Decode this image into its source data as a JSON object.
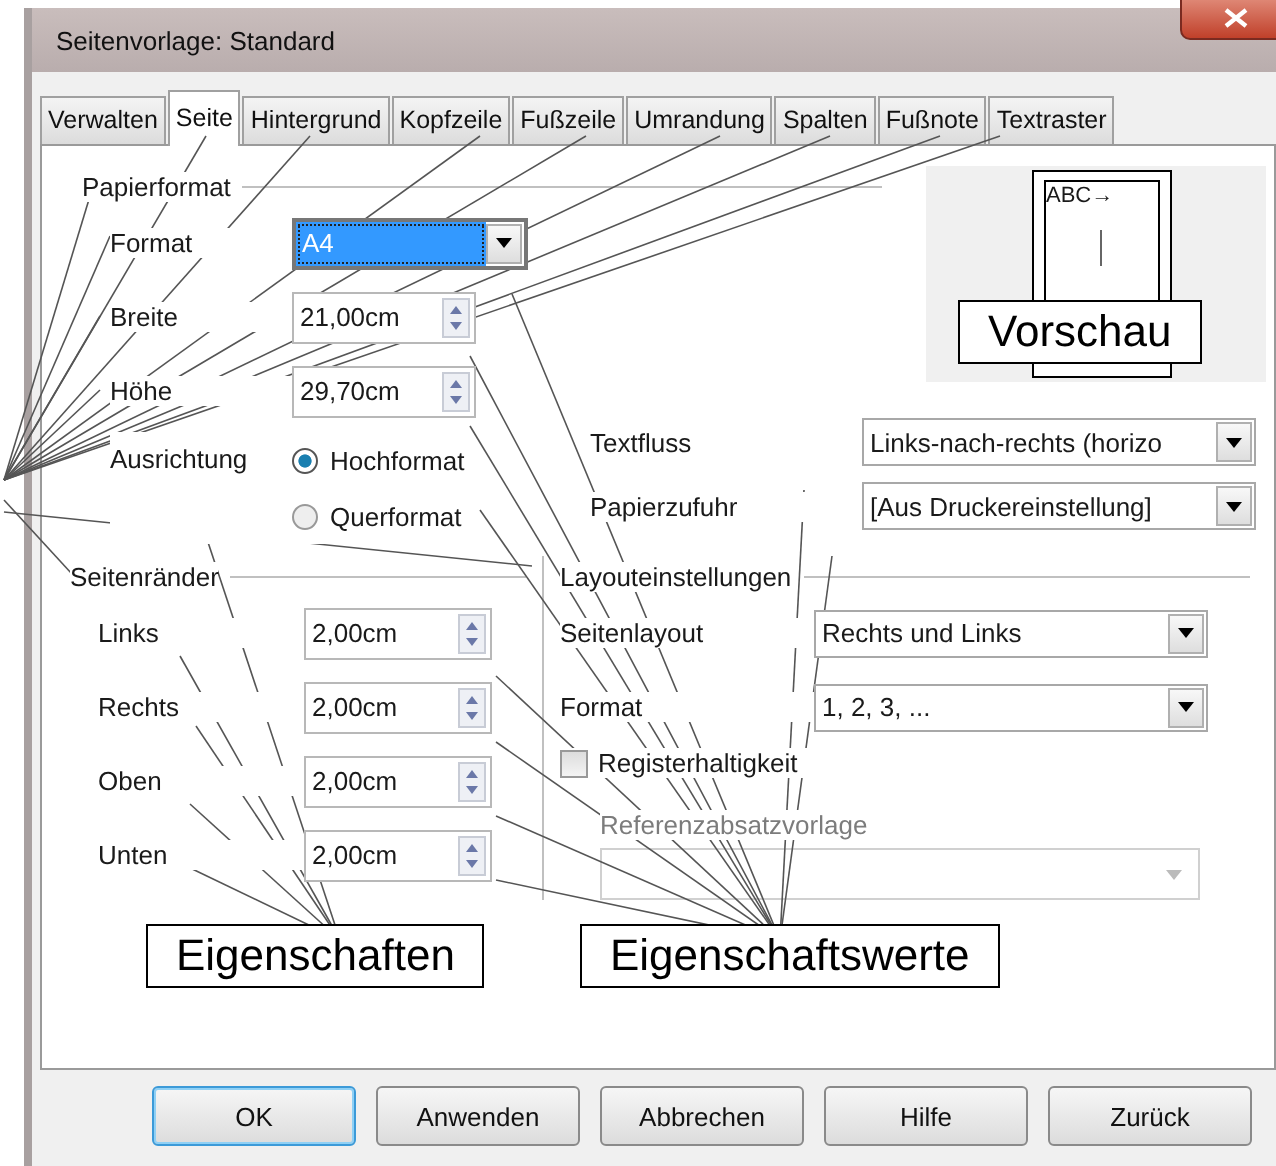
{
  "window": {
    "title": "Seitenvorlage: Standard"
  },
  "tabs": [
    {
      "label": "Verwalten",
      "selected": false
    },
    {
      "label": "Seite",
      "selected": true
    },
    {
      "label": "Hintergrund",
      "selected": false
    },
    {
      "label": "Kopfzeile",
      "selected": false
    },
    {
      "label": "Fußzeile",
      "selected": false
    },
    {
      "label": "Umrandung",
      "selected": false
    },
    {
      "label": "Spalten",
      "selected": false
    },
    {
      "label": "Fußnote",
      "selected": false
    },
    {
      "label": "Textraster",
      "selected": false
    }
  ],
  "paper_format": {
    "heading": "Papierformat",
    "format": {
      "label": "Format",
      "value": "A4",
      "focused": true
    },
    "width": {
      "label": "Breite",
      "value": "21,00cm"
    },
    "height": {
      "label": "Höhe",
      "value": "29,70cm"
    },
    "orientation": {
      "label": "Ausrichtung",
      "options": [
        {
          "label": "Hochformat",
          "selected": true
        },
        {
          "label": "Querformat",
          "selected": false
        }
      ]
    },
    "text_flow": {
      "label": "Textfluss",
      "value": "Links-nach-rechts (horizo"
    },
    "paper_tray": {
      "label": "Papierzufuhr",
      "value": "[Aus Druckereinstellung]"
    }
  },
  "preview": {
    "sample": "ABC→",
    "callout": "Vorschau"
  },
  "margins": {
    "heading": "Seitenränder",
    "fields": [
      {
        "label": "Links",
        "value": "2,00cm"
      },
      {
        "label": "Rechts",
        "value": "2,00cm"
      },
      {
        "label": "Oben",
        "value": "2,00cm"
      },
      {
        "label": "Unten",
        "value": "2,00cm"
      }
    ]
  },
  "layout": {
    "heading": "Layouteinstellungen",
    "page_layout": {
      "label": "Seitenlayout",
      "value": "Rechts und Links"
    },
    "numbering": {
      "label": "Format",
      "value": "1, 2, 3, ..."
    },
    "register_true": {
      "label": "Registerhaltigkeit",
      "checked": false
    },
    "reference_style": {
      "label": "Referenzabsatzvorlage",
      "disabled": true
    }
  },
  "callouts": [
    "Eigenschaften",
    "Eigenschaftswerte"
  ],
  "buttons": [
    {
      "label": "OK",
      "default": true
    },
    {
      "label": "Anwenden",
      "default": false
    },
    {
      "label": "Abbrechen",
      "default": false
    },
    {
      "label": "Hilfe",
      "default": false
    },
    {
      "label": "Zurück",
      "default": false
    }
  ]
}
